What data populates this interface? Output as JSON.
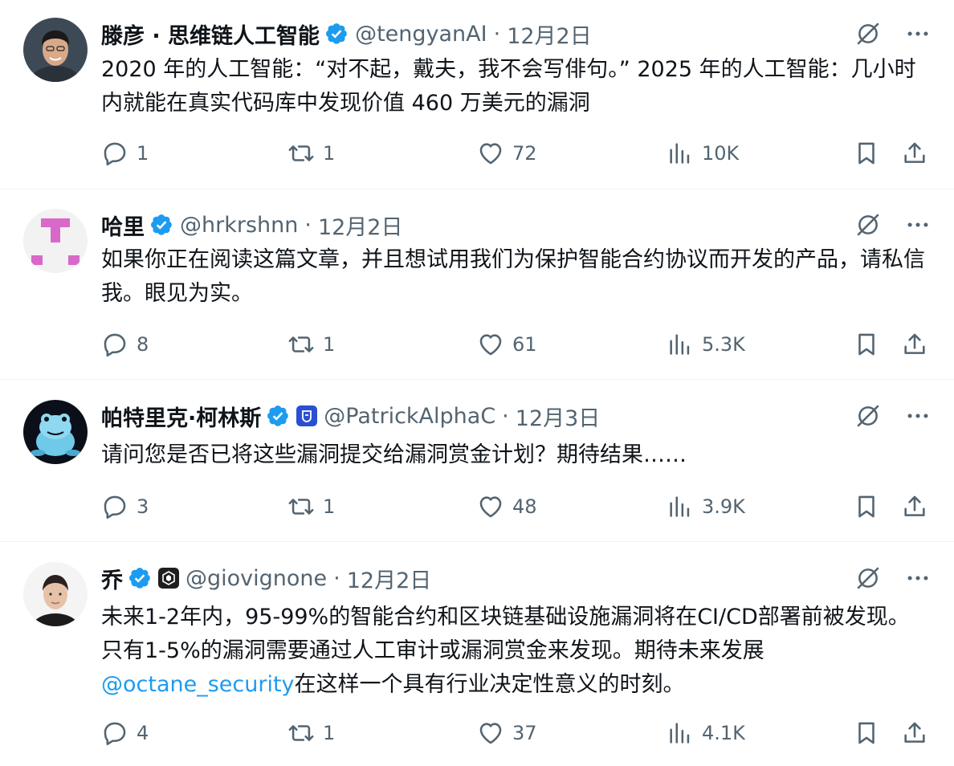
{
  "colors": {
    "verified": "#1d9bf0",
    "mention": "#1d9bf0",
    "secondary_text": "#536471",
    "primary_text": "#0f1419",
    "separator": "#eff3f4"
  },
  "tweets": [
    {
      "name": "滕彦 · 思维链人工智能",
      "handle": "@tengyanAI",
      "sep": "·",
      "date": "12月2日",
      "text": "2020 年的人工智能：“对不起，戴夫，我不会写俳句。” 2025 年的人工智能：几小时内就能在真实代码库中发现价值 460 万美元的漏洞",
      "replies": "1",
      "retweets": "1",
      "likes": "72",
      "views": "10K"
    },
    {
      "name": "哈里",
      "handle": "@hrkrshnn",
      "sep": "·",
      "date": "12月2日",
      "text": "如果你正在阅读这篇文章，并且想试用我们为保护智能合约协议而开发的产品，请私信我。眼见为实。",
      "replies": "8",
      "retweets": "1",
      "likes": "61",
      "views": "5.3K"
    },
    {
      "name": "帕特里克·柯林斯",
      "handle": "@PatrickAlphaC",
      "sep": "·",
      "date": "12月3日",
      "text": "请问您是否已将这些漏洞提交给漏洞赏金计划？期待结果……",
      "replies": "3",
      "retweets": "1",
      "likes": "48",
      "views": "3.9K"
    },
    {
      "name": "乔",
      "handle": "@giovignone",
      "sep": "·",
      "date": "12月2日",
      "text_before": "未来1-2年内，95-99%的智能合约和区块链基础设施漏洞将在CI/CD部署前被发现。只有1-5%的漏洞需要通过人工审计或漏洞赏金来发现。期待未来发展",
      "mention": "@octane_security",
      "text_after": "在这样一个具有行业决定性意义的时刻。",
      "replies": "4",
      "retweets": "1",
      "likes": "37",
      "views": "4.1K"
    }
  ],
  "icons": {
    "verified": "verified-check-icon",
    "grok": "grok-icon",
    "more": "more-icon",
    "reply": "reply-icon",
    "retweet": "retweet-icon",
    "like": "heart-icon",
    "views": "views-icon",
    "bookmark": "bookmark-icon",
    "share": "share-icon"
  }
}
